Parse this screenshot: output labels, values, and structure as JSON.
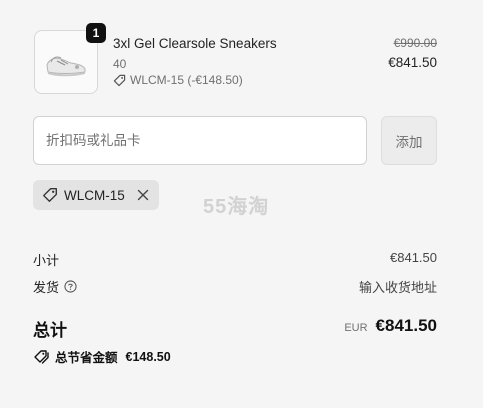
{
  "product": {
    "quantity": "1",
    "name": "3xl Gel Clearsole Sneakers",
    "variant": "40",
    "discount_applied": "WLCM-15 (-€148.50)",
    "price_original": "€990.00",
    "price_final": "€841.50",
    "image_icon": "sneaker-image"
  },
  "discount": {
    "placeholder": "折扣码或礼品卡",
    "value": "",
    "apply_label": "添加",
    "applied_code": "WLCM-15"
  },
  "watermark": "55海淘",
  "summary": {
    "subtotal_label": "小计",
    "subtotal_value": "€841.50",
    "shipping_label": "发货",
    "shipping_value": "输入收货地址",
    "total_label": "总计",
    "total_currency": "EUR",
    "total_value": "€841.50",
    "savings_label": "总节省金额",
    "savings_value": "€148.50"
  }
}
